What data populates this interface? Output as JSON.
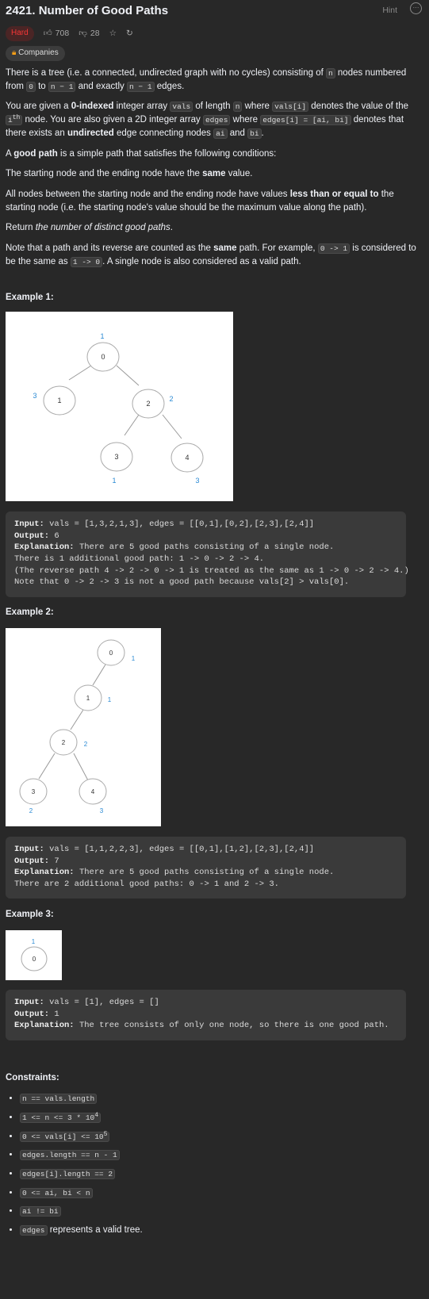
{
  "header": {
    "title": "2421. Number of Good Paths",
    "hint_label": "Hint",
    "difficulty": "Hard",
    "likes": "708",
    "dislikes": "28",
    "companies_label": "Companies"
  },
  "colors": {
    "hard": "#f63636",
    "accent_blue": "#2a8ad4",
    "bg": "#282828",
    "code_bg": "#3a3a3a"
  },
  "description": {
    "p1_a": "There is a tree (i.e. a connected, undirected graph with no cycles) consisting of",
    "p1_n": "n",
    "p1_b": "nodes numbered from",
    "p1_0": "0",
    "p1_c": "to",
    "p1_n1": "n − 1",
    "p1_d": "and exactly",
    "p1_n2": "n − 1",
    "p1_e": "edges.",
    "p2_a": "You are given a",
    "p2_bold": "0-indexed",
    "p2_b": "integer array",
    "p2_vals": "vals",
    "p2_c": "of length",
    "p2_n": "n",
    "p2_d": "where",
    "p2_valsi": "vals[i]",
    "p2_e": "denotes the value of the",
    "p2_ith": "i",
    "p2_th": "th",
    "p2_f": "node. You are also given a 2D integer array",
    "p2_edges": "edges",
    "p2_g": "where",
    "p2_edgesi": "edges[i] = [ai, bi]",
    "p2_h": "denotes that there exists an",
    "p2_bold2": "undirected",
    "p2_i": "edge connecting nodes",
    "p2_ai": "ai",
    "p2_j": "and",
    "p2_bi": "bi",
    "p2_k": ".",
    "p3_a": "A",
    "p3_bold": "good path",
    "p3_b": "is a simple path that satisfies the following conditions:",
    "p4_a": "The starting node and the ending node have the",
    "p4_bold": "same",
    "p4_b": "value.",
    "p5_a": "All nodes between the starting node and the ending node have values",
    "p5_bold": "less than or equal to",
    "p5_b": "the starting node (i.e. the starting node's value should be the maximum value along the path).",
    "p6_a": "Return",
    "p6_em": "the number of distinct good paths",
    "p6_b": ".",
    "p7_a": "Note that a path and its reverse are counted as the",
    "p7_bold": "same",
    "p7_b": "path. For example,",
    "p7_c1": "0 -> 1",
    "p7_c": "is considered to be the same as",
    "p7_c2": "1 -> 0",
    "p7_d": ". A single node is also considered as a valid path."
  },
  "examples": [
    {
      "title": "Example 1:",
      "input_label": "Input:",
      "input": "vals = [1,3,2,1,3], edges = [[0,1],[0,2],[2,3],[2,4]]",
      "output_label": "Output:",
      "output": "6",
      "explanation_label": "Explanation:",
      "explanation_lines": [
        "There are 5 good paths consisting of a single node.",
        "There is 1 additional good path: 1 -> 0 -> 2 -> 4.",
        "(The reverse path 4 -> 2 -> 0 -> 1 is treated as the same as 1 -> 0 -> 2 -> 4.)",
        "Note that 0 -> 2 -> 3 is not a good path because vals[2] > vals[0]."
      ],
      "tree_nodes": [
        "0",
        "1",
        "2",
        "3",
        "4"
      ],
      "tree_vals": [
        "1",
        "3",
        "2",
        "1",
        "3"
      ]
    },
    {
      "title": "Example 2:",
      "input_label": "Input:",
      "input": "vals = [1,1,2,2,3], edges = [[0,1],[1,2],[2,3],[2,4]]",
      "output_label": "Output:",
      "output": "7",
      "explanation_label": "Explanation:",
      "explanation_lines": [
        "There are 5 good paths consisting of a single node.",
        "There are 2 additional good paths: 0 -> 1 and 2 -> 3."
      ],
      "tree_nodes": [
        "0",
        "1",
        "2",
        "3",
        "4"
      ],
      "tree_vals": [
        "1",
        "1",
        "2",
        "2",
        "3"
      ]
    },
    {
      "title": "Example 3:",
      "input_label": "Input:",
      "input": "vals = [1], edges = []",
      "output_label": "Output:",
      "output": "1",
      "explanation_label": "Explanation:",
      "explanation_lines": [
        "The tree consists of only one node, so there is one good path."
      ],
      "tree_nodes": [
        "0"
      ],
      "tree_vals": [
        "1"
      ]
    }
  ],
  "constraints": {
    "title": "Constraints:",
    "items": [
      {
        "code": "n == vals.length"
      },
      {
        "code": "1 <= n <= 3 * 10",
        "sup": "4"
      },
      {
        "code": "0 <= vals[i] <= 10",
        "sup": "5"
      },
      {
        "code": "edges.length == n - 1"
      },
      {
        "code": "edges[i].length == 2"
      },
      {
        "code": "0 <= ai, bi < n"
      },
      {
        "code": "ai != bi"
      },
      {
        "code": "edges",
        "text": "represents a valid tree."
      }
    ]
  }
}
